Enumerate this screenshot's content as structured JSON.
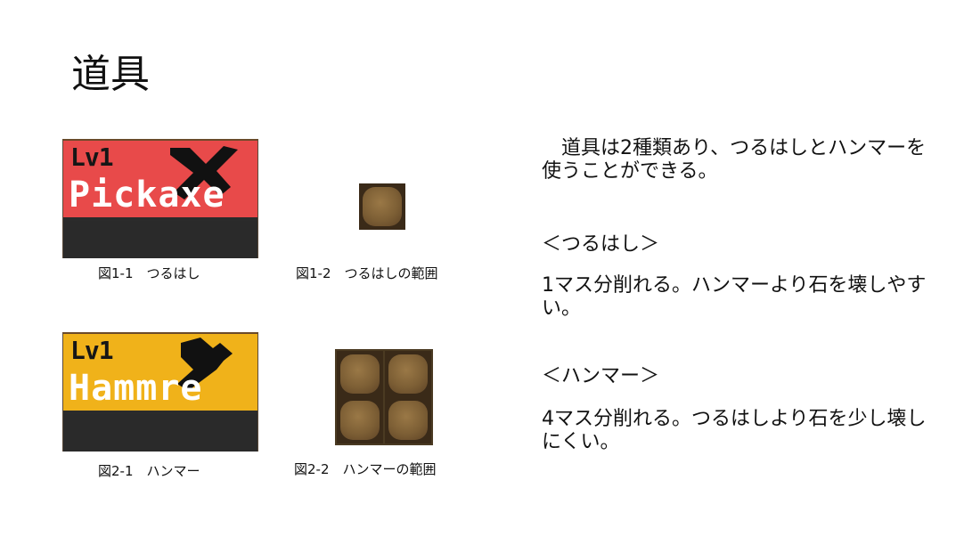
{
  "title": "道具",
  "figures": {
    "pickaxe_card": {
      "level": "Lv1",
      "name": "Pickaxe",
      "band_color": "#e84a4a"
    },
    "pickaxe_caption": "図1-1　つるはし",
    "pickaxe_range_caption": "図1-2　つるはしの範囲",
    "hammer_card": {
      "level": "Lv1",
      "name": "Hammre",
      "band_color": "#f0b21a"
    },
    "hammer_caption": "図2-1　ハンマー",
    "hammer_range_caption": "図2-2　ハンマーの範囲"
  },
  "text": {
    "intro": "　道具は2種類あり、つるはしとハンマーを使うことができる。",
    "pickaxe_heading": "＜つるはし＞",
    "pickaxe_desc": "1マス分削れる。ハンマーより石を壊しやすい。",
    "hammer_heading": "＜ハンマー＞",
    "hammer_desc": "4マス分削れる。つるはしより石を少し壊しにくい。"
  },
  "icons": {
    "pickaxe_card": "pickaxe-icon",
    "hammer_card": "hammer-icon"
  }
}
